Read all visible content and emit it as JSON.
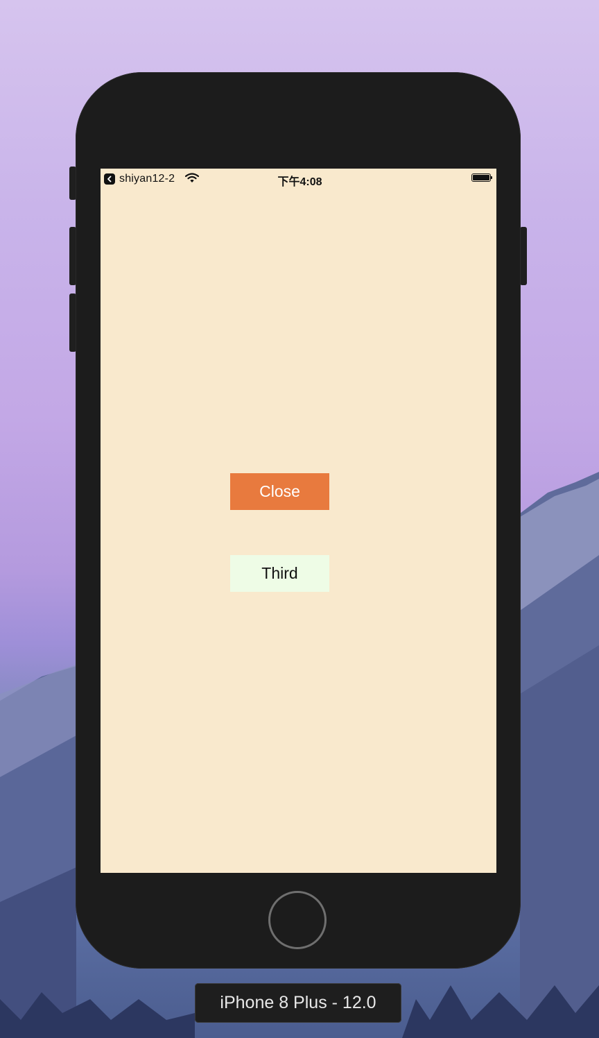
{
  "statusbar": {
    "back_app_label": "shiyan12-2",
    "time": "下午4:08",
    "battery_level": 1.0
  },
  "screen": {
    "background": "#f9e9cd",
    "close_button": {
      "label": "Close",
      "background": "#e87a3e"
    },
    "third_button": {
      "label": "Third",
      "background": "#eefce6"
    }
  },
  "simulator": {
    "device_label": "iPhone 8 Plus - 12.0"
  },
  "icons": {
    "back": "chevron-left-icon",
    "wifi": "wifi-icon",
    "battery": "battery-icon"
  }
}
